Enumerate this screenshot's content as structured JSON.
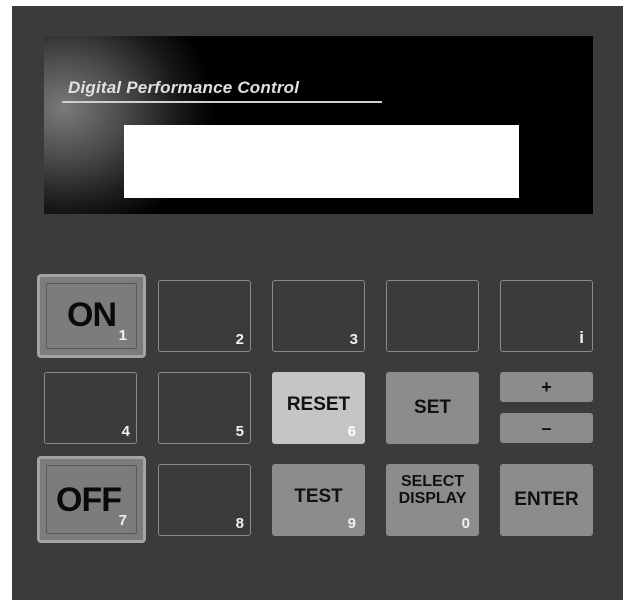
{
  "display": {
    "title": "Digital Performance Control",
    "lcd_text": ""
  },
  "keys": {
    "on": {
      "label": "ON",
      "num": "1"
    },
    "k2": {
      "num": "2"
    },
    "k3": {
      "num": "3"
    },
    "k_blank": {
      "num": ""
    },
    "info": {
      "num": "i"
    },
    "k4": {
      "num": "4"
    },
    "k5": {
      "num": "5"
    },
    "reset": {
      "label": "RESET",
      "num": "6"
    },
    "set": {
      "label": "SET"
    },
    "plus": {
      "label": "+"
    },
    "minus": {
      "label": "–"
    },
    "off": {
      "label": "OFF",
      "num": "7"
    },
    "k8": {
      "num": "8"
    },
    "test": {
      "label": "TEST",
      "num": "9"
    },
    "select": {
      "label_line1": "SELECT",
      "label_line2": "DISPLAY",
      "num": "0"
    },
    "enter": {
      "label": "ENTER"
    }
  }
}
